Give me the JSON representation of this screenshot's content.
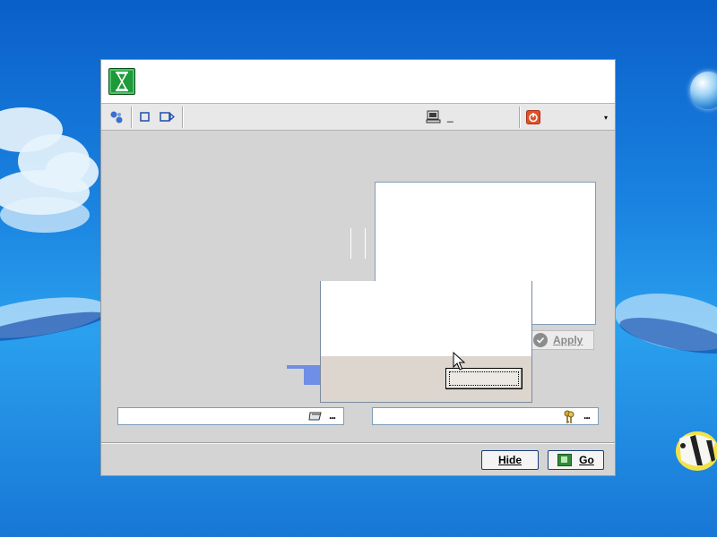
{
  "toolbar": {
    "items": [
      {
        "icon": "connect-icon"
      },
      {
        "icon": "stop-icon"
      },
      {
        "icon": "record-icon"
      }
    ],
    "status_icon": "computer-icon",
    "status_text": "_",
    "power_icon": "power-icon",
    "dropdown_glyph": "▾"
  },
  "apply_button": {
    "label": "Apply"
  },
  "fields": {
    "left_dots": "...",
    "right_dots": "..."
  },
  "footer": {
    "hide_label": "Hide",
    "go_label": "Go"
  },
  "colors": {
    "accent": "#1c3f78",
    "app_icon_bg": "#1e9a3a",
    "power_icon": "#e0522a"
  }
}
